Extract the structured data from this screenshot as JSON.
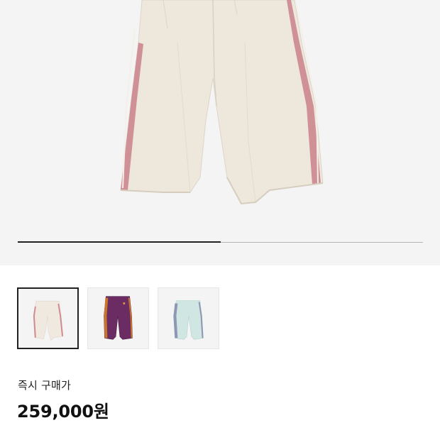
{
  "product": {
    "main_image": "cream-track-pants-photo",
    "gallery": {
      "current_index": 1,
      "total": 2
    },
    "thumbnails": [
      {
        "name": "cream-variant",
        "body_color": "#efe9df",
        "stripe_color": "#d08a8e",
        "active": true
      },
      {
        "name": "purple-variant",
        "body_color": "#6a2c63",
        "stripe_color": "#c9752a",
        "active": false
      },
      {
        "name": "mint-variant",
        "body_color": "#cfe6e2",
        "stripe_color": "#8f95b4",
        "active": false
      }
    ]
  },
  "purchase": {
    "label": "즉시 구매가",
    "price": "259,000원"
  },
  "colors": {
    "background": "#f4f4f4",
    "progress_fill": "#222222",
    "progress_track": "#b5b5b5"
  }
}
